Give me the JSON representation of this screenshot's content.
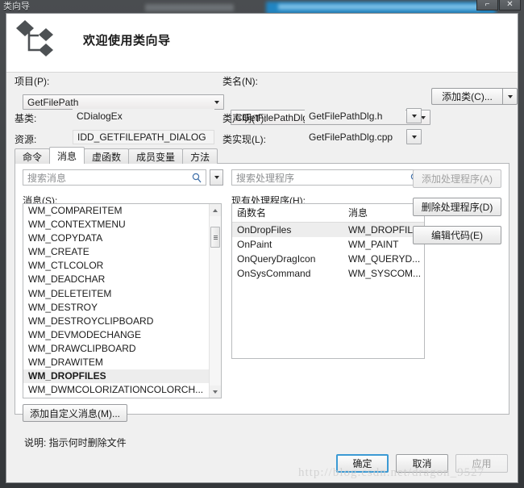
{
  "window": {
    "title": "类向导",
    "buttons": {
      "restore": "⌐",
      "close": "✕"
    }
  },
  "banner": {
    "title": "欢迎使用类向导",
    "logo_icon": "class-wizard-icon"
  },
  "fields": {
    "project_label": "项目(P):",
    "project_value": "GetFilePath",
    "class_name_label": "类名(N):",
    "class_name_value": "CGetFilePathDlg",
    "base_class_label": "基类:",
    "base_class_value": "CDialogEx",
    "class_decl_label": "类声明(T):",
    "class_decl_value": "GetFilePathDlg.h",
    "resource_label": "资源:",
    "resource_value": "IDD_GETFILEPATH_DIALOG",
    "class_impl_label": "类实现(L):",
    "class_impl_value": "GetFilePathDlg.cpp",
    "add_class_label": "添加类(C)..."
  },
  "tabs": [
    {
      "label": "命令",
      "active": false
    },
    {
      "label": "消息",
      "active": true
    },
    {
      "label": "虚函数",
      "active": false
    },
    {
      "label": "成员变量",
      "active": false
    },
    {
      "label": "方法",
      "active": false
    }
  ],
  "messages_pane": {
    "search_placeholder": "搜索消息",
    "search_value": "",
    "list_label": "消息(S):",
    "items": [
      {
        "name": "WM_COMPAREITEM",
        "selected": false
      },
      {
        "name": "WM_CONTEXTMENU",
        "selected": false
      },
      {
        "name": "WM_COPYDATA",
        "selected": false
      },
      {
        "name": "WM_CREATE",
        "selected": false
      },
      {
        "name": "WM_CTLCOLOR",
        "selected": false
      },
      {
        "name": "WM_DEADCHAR",
        "selected": false
      },
      {
        "name": "WM_DELETEITEM",
        "selected": false
      },
      {
        "name": "WM_DESTROY",
        "selected": false
      },
      {
        "name": "WM_DESTROYCLIPBOARD",
        "selected": false
      },
      {
        "name": "WM_DEVMODECHANGE",
        "selected": false
      },
      {
        "name": "WM_DRAWCLIPBOARD",
        "selected": false
      },
      {
        "name": "WM_DRAWITEM",
        "selected": false
      },
      {
        "name": "WM_DROPFILES",
        "selected": true
      },
      {
        "name": "WM_DWMCOLORIZATIONCOLORCH...",
        "selected": false
      }
    ],
    "add_custom_label": "添加自定义消息(M)...",
    "description": "说明:  指示何时删除文件"
  },
  "handlers_pane": {
    "search_placeholder": "搜索处理程序",
    "search_value": "",
    "list_label": "现有处理程序(H):",
    "columns": [
      "函数名",
      "消息"
    ],
    "rows": [
      {
        "func": "OnDropFiles",
        "msg": "WM_DROPFIL...",
        "selected": true
      },
      {
        "func": "OnPaint",
        "msg": "WM_PAINT",
        "selected": false
      },
      {
        "func": "OnQueryDragIcon",
        "msg": "WM_QUERYD...",
        "selected": false
      },
      {
        "func": "OnSysCommand",
        "msg": "WM_SYSCOM...",
        "selected": false
      }
    ],
    "add_handler_label": "添加处理程序(A)",
    "delete_handler_label": "删除处理程序(D)",
    "edit_code_label": "编辑代码(E)"
  },
  "footer": {
    "ok_label": "确定",
    "cancel_label": "取消",
    "apply_label": "应用"
  },
  "watermark": "http://blog.csdn.net/dragon_9527",
  "colors": {
    "accent_blue": "#3c9ad4",
    "dialog_bg": "#f0f0f0",
    "selection": "#ededed",
    "frame": "#3c3f42"
  }
}
